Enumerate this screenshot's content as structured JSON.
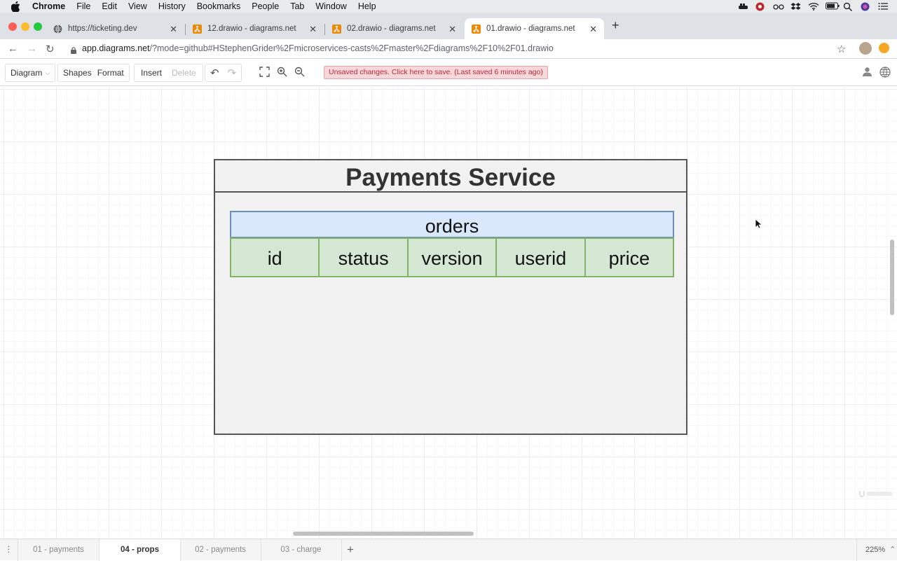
{
  "menubar": {
    "app": "Chrome",
    "items": [
      "File",
      "Edit",
      "View",
      "History",
      "Bookmarks",
      "People",
      "Tab",
      "Window",
      "Help"
    ]
  },
  "browser": {
    "tabs": [
      {
        "title": "https://ticketing.dev",
        "favicon": "globe-icon",
        "active": false
      },
      {
        "title": "12.drawio - diagrams.net",
        "favicon": "drawio-icon",
        "active": false
      },
      {
        "title": "02.drawio - diagrams.net",
        "favicon": "drawio-icon",
        "active": false
      },
      {
        "title": "01.drawio - diagrams.net",
        "favicon": "drawio-icon",
        "active": true
      }
    ],
    "url_host": "app.diagrams.net",
    "url_rest": "/?mode=github#HStephenGrider%2Fmicroservices-casts%2Fmaster%2Fdiagrams%2F10%2F01.drawio"
  },
  "toolbar": {
    "diagram": "Diagram",
    "shapes": "Shapes",
    "format": "Format",
    "insert": "Insert",
    "delete": "Delete",
    "unsaved": "Unsaved changes. Click here to save. (Last saved 6 minutes ago)"
  },
  "diagram": {
    "container_title": "Payments Service",
    "table_name": "orders",
    "columns": [
      "id",
      "status",
      "version",
      "userid",
      "price"
    ]
  },
  "pages": {
    "tabs": [
      "01 - payments",
      "04 - props",
      "02 - payments",
      "03 - charge"
    ],
    "active_index": 1,
    "zoom": "225%"
  },
  "colors": {
    "table_header_fill": "#dae8fc",
    "table_header_stroke": "#6c8ebf",
    "column_fill": "#d5e8d4",
    "column_stroke": "#82b366",
    "container_fill": "#f2f2f2",
    "unsaved_bg": "#f8d7da"
  }
}
